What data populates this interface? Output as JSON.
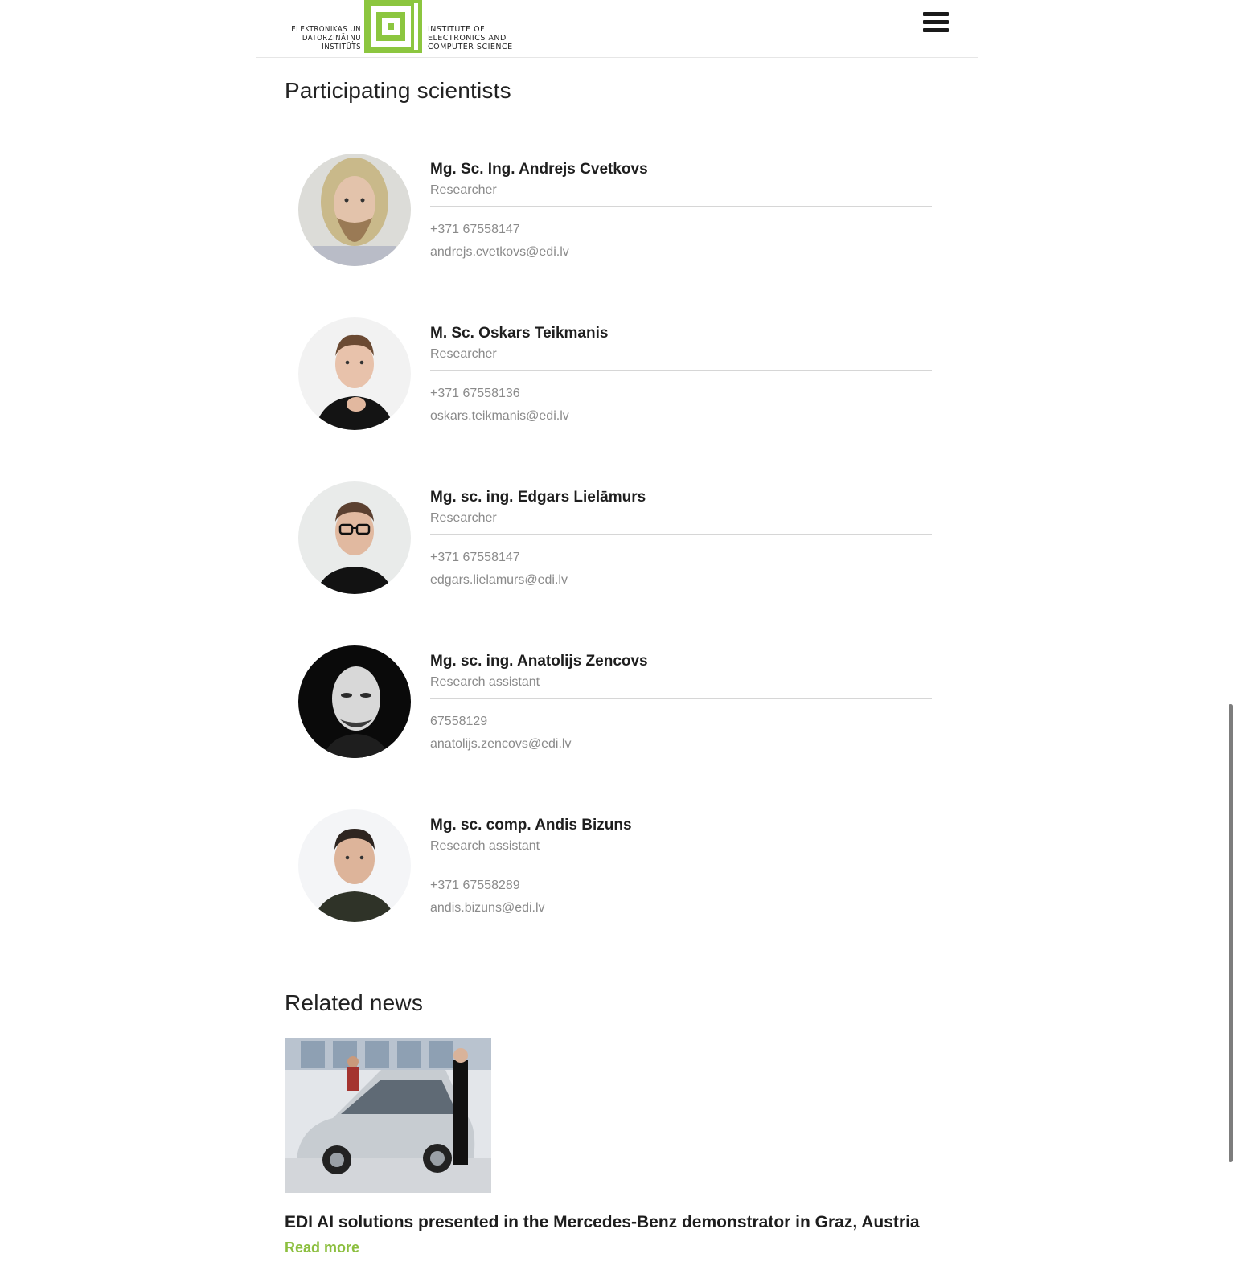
{
  "header": {
    "logo_left_lines": [
      "ELEKTRONIKAS UN",
      "DATORZINĀTŅU",
      "INSTITŪTS"
    ],
    "logo_right_lines": [
      "INSTITUTE OF",
      "ELECTRONICS AND",
      "COMPUTER SCIENCE"
    ],
    "brand_color": "#8cc63f",
    "menu_icon": "hamburger-menu-icon"
  },
  "scientists": {
    "title": "Participating scientists",
    "people": [
      {
        "name": "Mg. Sc. Ing. Andrejs Cvetkovs",
        "role": "Researcher",
        "phone": "+371 67558147",
        "email": "andrejs.cvetkovs@edi.lv"
      },
      {
        "name": "M. Sc. Oskars Teikmanis",
        "role": "Researcher",
        "phone": "+371 67558136",
        "email": "oskars.teikmanis@edi.lv"
      },
      {
        "name": "Mg. sc. ing. Edgars Lielāmurs",
        "role": "Researcher",
        "phone": "+371 67558147",
        "email": "edgars.lielamurs@edi.lv"
      },
      {
        "name": "Mg. sc. ing. Anatolijs Zencovs",
        "role": "Research assistant",
        "phone": "67558129",
        "email": "anatolijs.zencovs@edi.lv"
      },
      {
        "name": "Mg. sc. comp. Andis Bizuns",
        "role": "Research assistant",
        "phone": "+371 67558289",
        "email": "andis.bizuns@edi.lv"
      }
    ]
  },
  "news": {
    "title": "Related news",
    "items": [
      {
        "title": "EDI AI solutions presented in the Mercedes-Benz demonstrator in Graz, Austria",
        "read_more": "Read more"
      }
    ]
  },
  "colors": {
    "accent": "#8cbf3f",
    "muted_text": "#8a8a8a"
  }
}
